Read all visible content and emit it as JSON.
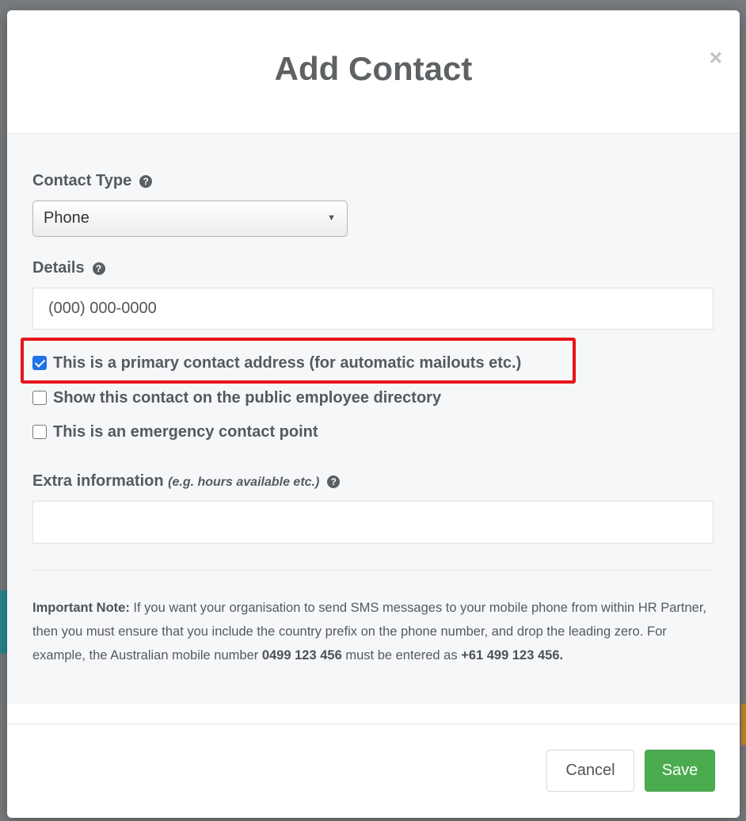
{
  "modal": {
    "title": "Add Contact",
    "close_glyph": "×"
  },
  "contact_type": {
    "label": "Contact Type",
    "selected": "Phone"
  },
  "details": {
    "label": "Details",
    "placeholder": "(000) 000-0000"
  },
  "checkboxes": [
    {
      "label": "This is a primary contact address (for automatic mailouts etc.)",
      "checked": true
    },
    {
      "label": "Show this contact on the public employee directory",
      "checked": false
    },
    {
      "label": "This is an emergency contact point",
      "checked": false
    }
  ],
  "extra_info": {
    "label": "Extra information",
    "hint": "(e.g. hours available etc.)",
    "value": ""
  },
  "note": {
    "heading": "Important Note:",
    "text1": " If you want your organisation to send SMS messages to your mobile phone from within HR Partner, then you must ensure that you include the country prefix on the phone number, and drop the leading zero. For example, the Australian mobile number ",
    "example_local": "0499 123 456",
    "text2": " must be entered as ",
    "example_intl": "+61 499 123 456."
  },
  "footer": {
    "cancel_label": "Cancel",
    "save_label": "Save"
  },
  "icons": {
    "help": "question-circle-icon",
    "close": "close-icon",
    "caret": "caret-down-icon"
  },
  "colors": {
    "save_button": "#4bab4f",
    "checkbox_checked": "#1f72e8",
    "highlight_box": "#e8141b"
  }
}
